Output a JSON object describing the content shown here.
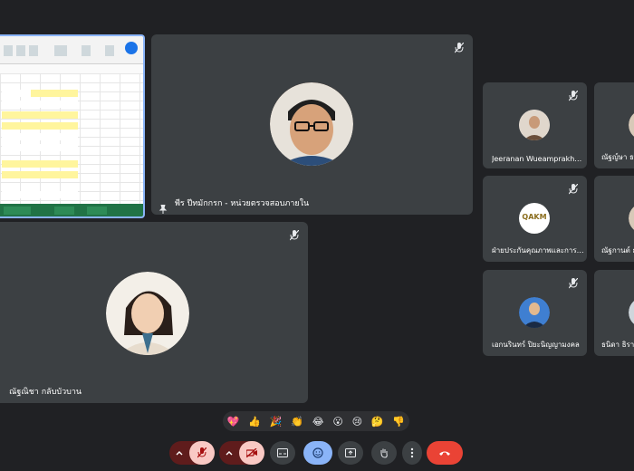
{
  "tiles": {
    "presenter_name": "พีร ปีทมักกรก - หน่วยตรวจสอบภายใน",
    "speaker_name": "ณัฐณิชา กลับบัวบาน",
    "side": [
      {
        "name": "Jeeranan Wueamprakh…"
      },
      {
        "name": "ณัฐญ์ษา ธ"
      },
      {
        "name": "ฝ่ายประกันคุณภาพและการ…"
      },
      {
        "name": "ณัฐกานต์ ธ"
      },
      {
        "name": "เอกนรินทร์ ปิยะนิญญามงคล"
      },
      {
        "name": "ธนิดา ธิรา"
      }
    ],
    "qakm_logo_text": "QAKM"
  },
  "reactions": [
    "💖",
    "👍",
    "🎉",
    "👏",
    "😂",
    "😮",
    "😢",
    "🤔",
    "👎"
  ],
  "colors": {
    "bg": "#202124",
    "tile": "#3c4043",
    "accent": "#8ab4f8",
    "end_call": "#ea4335",
    "muted": "#f28b82"
  },
  "icons": {
    "mic_off": "mic-off-icon",
    "cam_off": "camera-off-icon",
    "caption": "captions-icon",
    "emoji": "emoji-icon",
    "present": "present-icon",
    "hand": "raise-hand-icon",
    "more": "more-vert-icon",
    "end": "end-call-icon",
    "pin": "pin-icon"
  }
}
